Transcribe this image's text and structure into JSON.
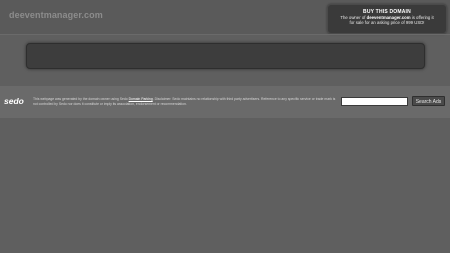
{
  "header": {
    "domain_title": "deeventmanager.com"
  },
  "buy_box": {
    "title": "BUY THIS DOMAIN",
    "line1_prefix": "The owner of ",
    "domain": "deeventmanager.com",
    "line1_suffix": " is offering it",
    "line2": "for sale for an asking price of 999 USD!"
  },
  "footer": {
    "logo": "sedo",
    "disclaimer_prefix": "This webpage was generated by the domain owner using Sedo ",
    "disclaimer_link": "Domain Parking",
    "disclaimer_suffix": ". Disclaimer: Sedo maintains no relationship with third party advertisers. Reference to any specific service or trade mark is not controlled by Sedo nor does it constitute or imply its association, endorsement or recommendation."
  },
  "search": {
    "input_value": "",
    "button_label": "Search Ads"
  }
}
